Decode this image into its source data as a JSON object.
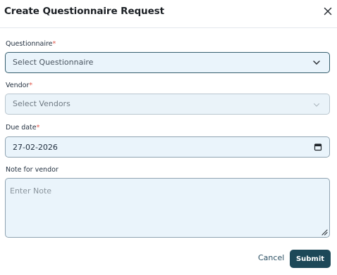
{
  "dialog": {
    "title": "Create Questionnaire Request"
  },
  "form": {
    "questionnaire": {
      "label": "Questionnaire",
      "required_mark": "*",
      "placeholder": "Select Questionnaire"
    },
    "vendor": {
      "label": "Vendor",
      "required_mark": "*",
      "placeholder": "Select Vendors"
    },
    "due_date": {
      "label": "Due date",
      "required_mark": "*",
      "value": "27-02-2026"
    },
    "note": {
      "label": "Note for vendor",
      "placeholder": "Enter Note"
    }
  },
  "actions": {
    "cancel_label": "Cancel",
    "submit_label": "Submit"
  },
  "icons": {
    "close": "close-icon",
    "dropdown": "chevron-down-icon",
    "calendar": "calendar-icon",
    "resize": "resize-handle-icon"
  },
  "colors": {
    "required": "#e0564a",
    "field_bg": "#eaf4fb",
    "primary": "#1d4858"
  }
}
